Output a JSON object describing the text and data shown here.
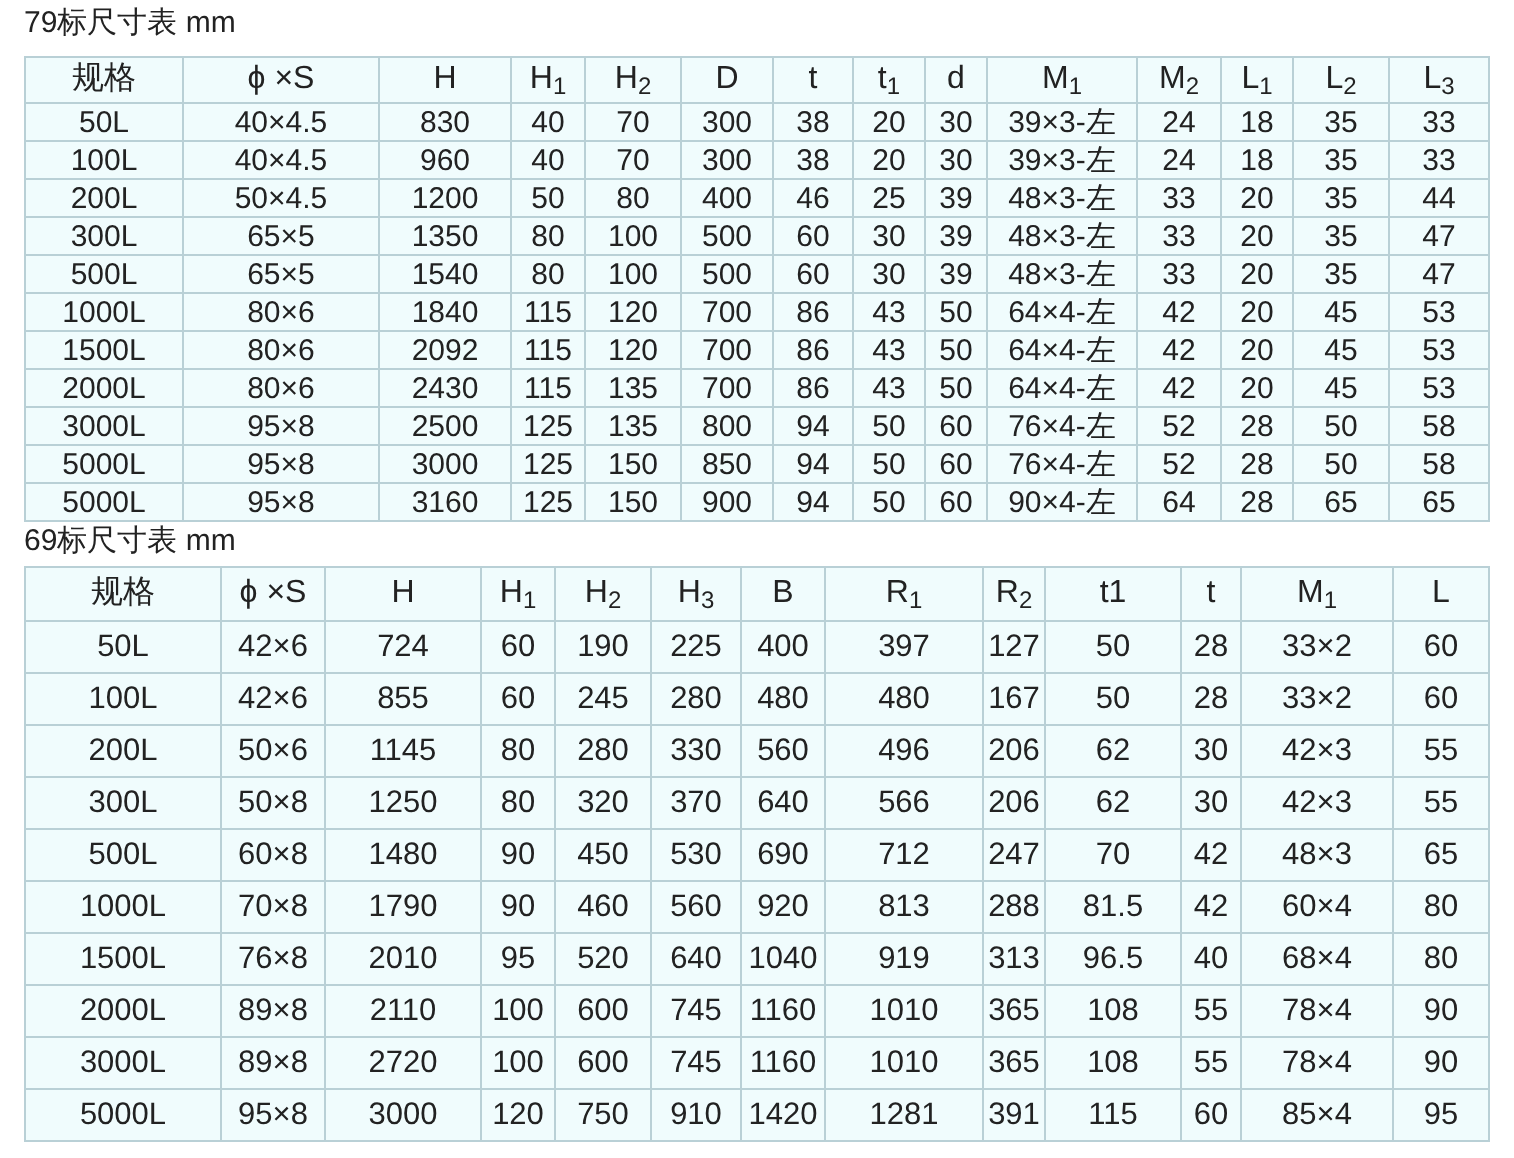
{
  "tables": [
    {
      "title": "79标尺寸表 mm",
      "columns": [
        "规格",
        "ϕ ×S",
        "H",
        "H$_{1}$",
        "H$_{2}$",
        "D",
        "t",
        "t$_{1}$",
        "d",
        "M$_{1}$",
        "M$_{2}$",
        "L$_{1}$",
        "L$_{2}$",
        "L$_{3}$"
      ],
      "rows": [
        [
          "50L",
          "40×4.5",
          "830",
          "40",
          "70",
          "300",
          "38",
          "20",
          "30",
          "39×3-左",
          "24",
          "18",
          "35",
          "33"
        ],
        [
          "100L",
          "40×4.5",
          "960",
          "40",
          "70",
          "300",
          "38",
          "20",
          "30",
          "39×3-左",
          "24",
          "18",
          "35",
          "33"
        ],
        [
          "200L",
          "50×4.5",
          "1200",
          "50",
          "80",
          "400",
          "46",
          "25",
          "39",
          "48×3-左",
          "33",
          "20",
          "35",
          "44"
        ],
        [
          "300L",
          "65×5",
          "1350",
          "80",
          "100",
          "500",
          "60",
          "30",
          "39",
          "48×3-左",
          "33",
          "20",
          "35",
          "47"
        ],
        [
          "500L",
          "65×5",
          "1540",
          "80",
          "100",
          "500",
          "60",
          "30",
          "39",
          "48×3-左",
          "33",
          "20",
          "35",
          "47"
        ],
        [
          "1000L",
          "80×6",
          "1840",
          "115",
          "120",
          "700",
          "86",
          "43",
          "50",
          "64×4-左",
          "42",
          "20",
          "45",
          "53"
        ],
        [
          "1500L",
          "80×6",
          "2092",
          "115",
          "120",
          "700",
          "86",
          "43",
          "50",
          "64×4-左",
          "42",
          "20",
          "45",
          "53"
        ],
        [
          "2000L",
          "80×6",
          "2430",
          "115",
          "135",
          "700",
          "86",
          "43",
          "50",
          "64×4-左",
          "42",
          "20",
          "45",
          "53"
        ],
        [
          "3000L",
          "95×8",
          "2500",
          "125",
          "135",
          "800",
          "94",
          "50",
          "60",
          "76×4-左",
          "52",
          "28",
          "50",
          "58"
        ],
        [
          "5000L",
          "95×8",
          "3000",
          "125",
          "150",
          "850",
          "94",
          "50",
          "60",
          "76×4-左",
          "52",
          "28",
          "50",
          "58"
        ],
        [
          "5000L",
          "95×8",
          "3160",
          "125",
          "150",
          "900",
          "94",
          "50",
          "60",
          "90×4-左",
          "64",
          "28",
          "65",
          "65"
        ]
      ]
    },
    {
      "title": "69标尺寸表 mm",
      "columns": [
        "规格",
        "ϕ ×S",
        "H",
        "H$_{1}$",
        "H$_{2}$",
        "H$_{3}$",
        "B",
        "R$_{1}$",
        "R$_{2}$",
        "t1",
        "t",
        "M$_{1}$",
        "L"
      ],
      "rows": [
        [
          "50L",
          "42×6",
          "724",
          "60",
          "190",
          "225",
          "400",
          "397",
          "127",
          "50",
          "28",
          "33×2",
          "60"
        ],
        [
          "100L",
          "42×6",
          "855",
          "60",
          "245",
          "280",
          "480",
          "480",
          "167",
          "50",
          "28",
          "33×2",
          "60"
        ],
        [
          "200L",
          "50×6",
          "1145",
          "80",
          "280",
          "330",
          "560",
          "496",
          "206",
          "62",
          "30",
          "42×3",
          "55"
        ],
        [
          "300L",
          "50×8",
          "1250",
          "80",
          "320",
          "370",
          "640",
          "566",
          "206",
          "62",
          "30",
          "42×3",
          "55"
        ],
        [
          "500L",
          "60×8",
          "1480",
          "90",
          "450",
          "530",
          "690",
          "712",
          "247",
          "70",
          "42",
          "48×3",
          "65"
        ],
        [
          "1000L",
          "70×8",
          "1790",
          "90",
          "460",
          "560",
          "920",
          "813",
          "288",
          "81.5",
          "42",
          "60×4",
          "80"
        ],
        [
          "1500L",
          "76×8",
          "2010",
          "95",
          "520",
          "640",
          "1040",
          "919",
          "313",
          "96.5",
          "40",
          "68×4",
          "80"
        ],
        [
          "2000L",
          "89×8",
          "2110",
          "100",
          "600",
          "745",
          "1160",
          "1010",
          "365",
          "108",
          "55",
          "78×4",
          "90"
        ],
        [
          "3000L",
          "89×8",
          "2720",
          "100",
          "600",
          "745",
          "1160",
          "1010",
          "365",
          "108",
          "55",
          "78×4",
          "90"
        ],
        [
          "5000L",
          "95×8",
          "3000",
          "120",
          "750",
          "910",
          "1420",
          "1281",
          "391",
          "115",
          "60",
          "85×4",
          "95"
        ]
      ]
    }
  ]
}
